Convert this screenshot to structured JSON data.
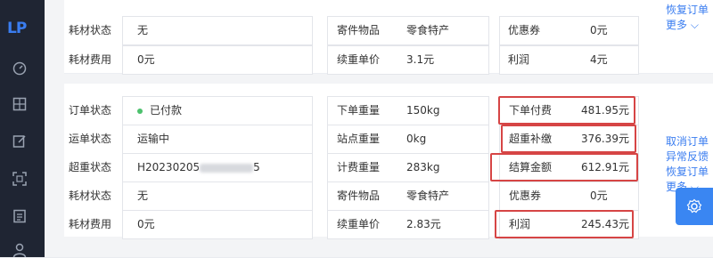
{
  "app": {
    "logo": "LP"
  },
  "sidebar": {
    "icons": [
      "dashboard-icon",
      "grid-icon",
      "edit-icon",
      "scan-icon",
      "document-icon",
      "user-icon"
    ]
  },
  "top_section": {
    "rows": [
      {
        "label1": "耗材状态",
        "value1": "无",
        "label2": "寄件物品",
        "value2": "零食特产",
        "label3": "优惠券",
        "value3": "0元"
      },
      {
        "label1": "耗材费用",
        "value1": "0元",
        "label2": "续重单价",
        "value2": "3.1元",
        "label3": "利润",
        "value3": "4元"
      }
    ],
    "actions": {
      "restore": "恢复订单",
      "more": "更多"
    }
  },
  "bottom_section": {
    "rows": [
      {
        "label1": "订单状态",
        "value1": "已付款",
        "label2": "下单重量",
        "value2": "150kg",
        "label3": "下单付费",
        "value3": "481.95元"
      },
      {
        "label1": "运单状态",
        "value1": "运输中",
        "label2": "站点重量",
        "value2": "0kg",
        "label3": "超重补缴",
        "value3": "376.39元"
      },
      {
        "label1": "超重状态",
        "value1": "H20230205",
        "value1_suffix": "5",
        "label2": "计费重量",
        "value2": "283kg",
        "label3": "结算金额",
        "value3": "612.91元"
      },
      {
        "label1": "耗材状态",
        "value1": "无",
        "label2": "寄件物品",
        "value2": "零食特产",
        "label3": "优惠券",
        "value3": "0元"
      },
      {
        "label1": "耗材费用",
        "value1": "0元",
        "label2": "续重单价",
        "value2": "2.83元",
        "label3": "利润",
        "value3": "245.43元"
      }
    ],
    "actions": {
      "cancel": "取消订单",
      "feedback": "异常反馈",
      "restore": "恢复订单",
      "more": "更多"
    }
  },
  "colors": {
    "sidebar": "#1f2533",
    "accent": "#3a86f2",
    "highlight": "#d64545",
    "status_dot": "#4cc16d"
  }
}
